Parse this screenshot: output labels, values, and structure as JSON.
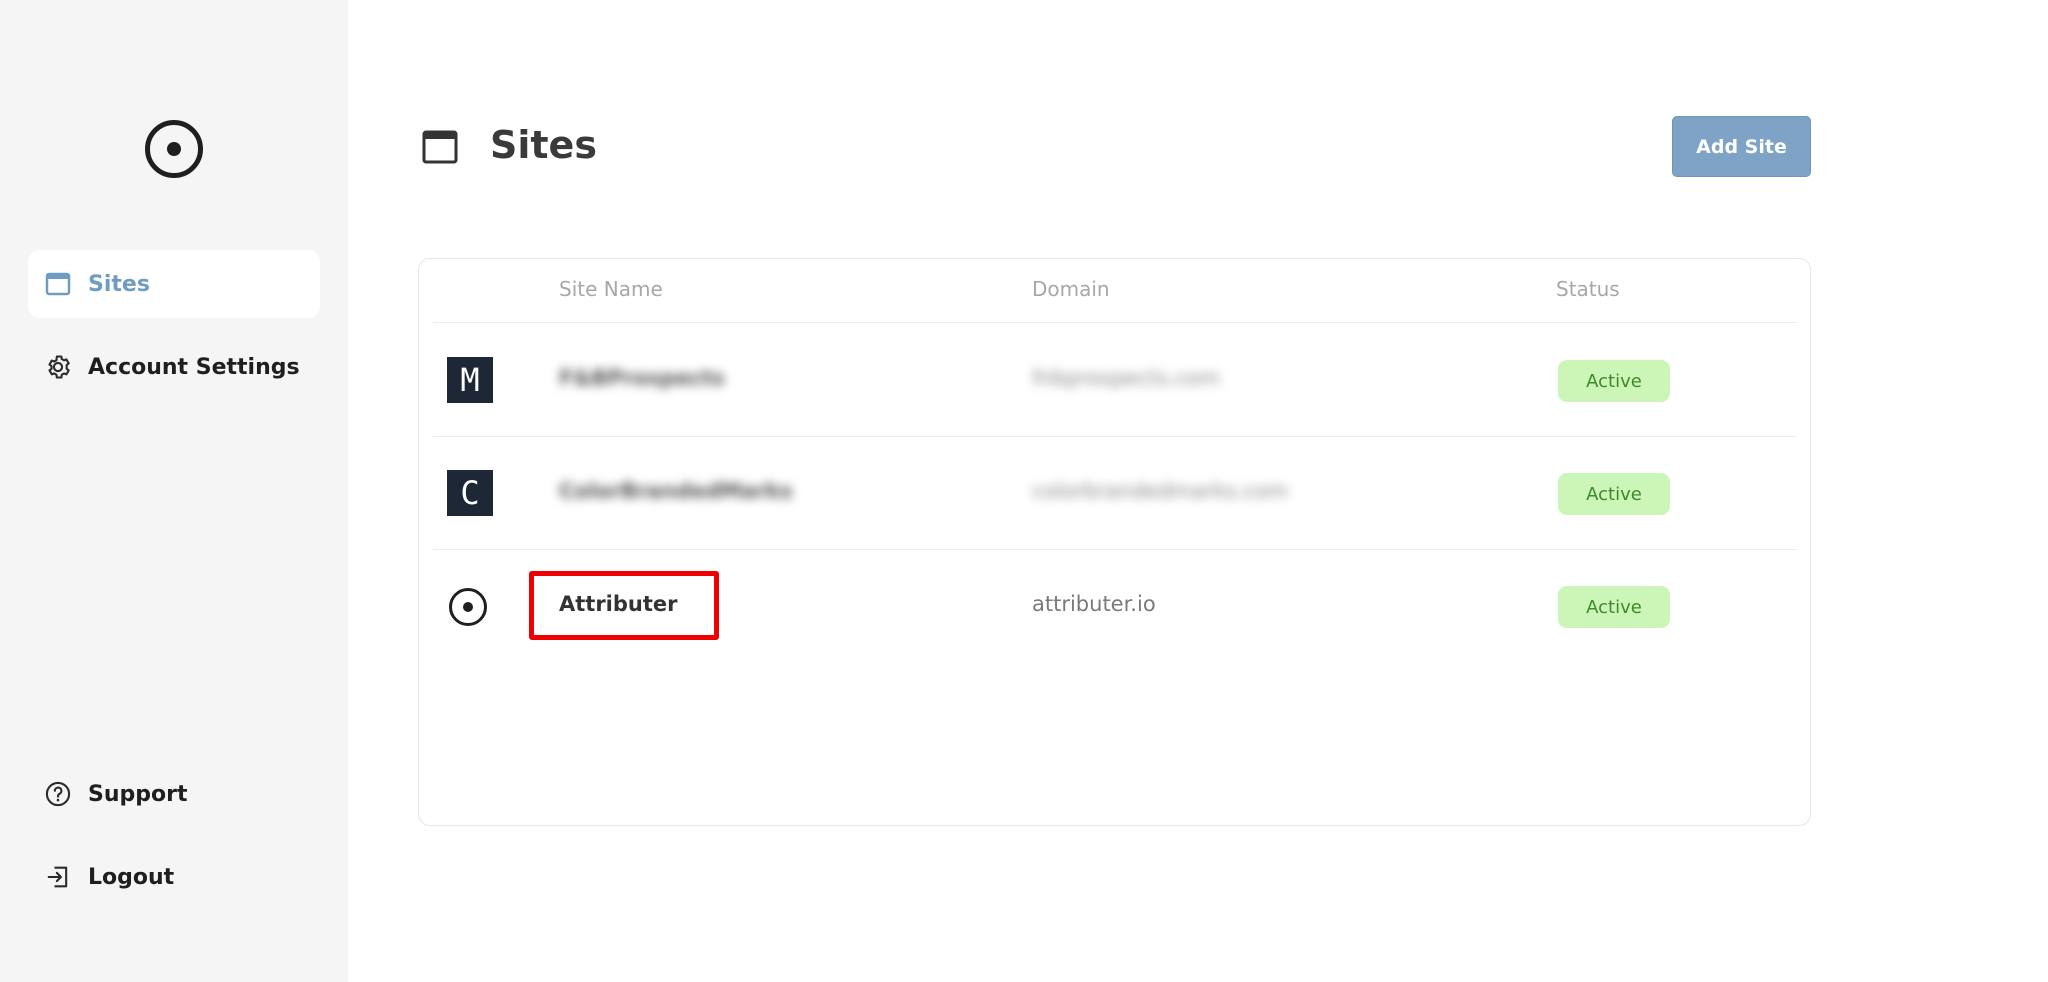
{
  "sidebar": {
    "logo_icon": "target-circle-icon",
    "nav": [
      {
        "label": "Sites",
        "icon": "browser-window-icon",
        "active": true
      },
      {
        "label": "Account Settings",
        "icon": "gear-icon",
        "active": false
      }
    ],
    "footer_nav": [
      {
        "label": "Support",
        "icon": "help-circle-icon"
      },
      {
        "label": "Logout",
        "icon": "logout-icon"
      }
    ]
  },
  "header": {
    "title": "Sites",
    "icon": "browser-window-icon",
    "add_button_label": "Add Site"
  },
  "table": {
    "columns": [
      "Site Name",
      "Domain",
      "Status"
    ],
    "rows": [
      {
        "avatar": "M",
        "name": "F&BProspects",
        "domain": "fnbprospects.com",
        "status": "Active",
        "blurred": true
      },
      {
        "avatar": "C",
        "name": "ColorBrandedMarks",
        "domain": "colorbrandedmarks.com",
        "status": "Active",
        "blurred": true
      },
      {
        "avatar": "",
        "name": "Attributer",
        "domain": "attributer.io",
        "status": "Active",
        "blurred": false
      }
    ]
  },
  "colors": {
    "accent": "#6f9cc2",
    "button_bg": "#7ea3c6",
    "status_bg": "#ccf5b8",
    "status_text": "#3e8a2a",
    "highlight": "#ee0000",
    "sidebar_bg": "#f5f5f5"
  }
}
